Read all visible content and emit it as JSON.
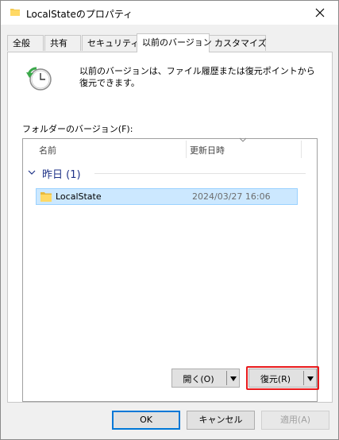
{
  "window": {
    "title": "LocalStateのプロパティ",
    "icon": "folder-icon"
  },
  "tabs": [
    {
      "label": "全般",
      "active": false
    },
    {
      "label": "共有",
      "active": false
    },
    {
      "label": "セキュリティ",
      "active": false
    },
    {
      "label": "以前のバージョン",
      "active": true
    },
    {
      "label": "カスタマイズ",
      "active": false
    }
  ],
  "panel": {
    "description": "以前のバージョンは、ファイル履歴または復元ポイントから復元できます。",
    "folder_versions_label": "フォルダーのバージョン(F):",
    "columns": {
      "name": "名前",
      "date": "更新日時"
    },
    "group": {
      "label": "昨日 (1)"
    },
    "rows": [
      {
        "name": "LocalState",
        "date": "2024/03/27 16:06",
        "selected": true
      }
    ],
    "open_button": "開く(O)",
    "restore_button": "復元(R)"
  },
  "footer": {
    "ok": "OK",
    "cancel": "キャンセル",
    "apply": "適用(A)"
  },
  "colors": {
    "accent": "#0078d7",
    "selection": "#cce8ff",
    "highlight": "#e8191b",
    "group_text": "#1e3287"
  }
}
